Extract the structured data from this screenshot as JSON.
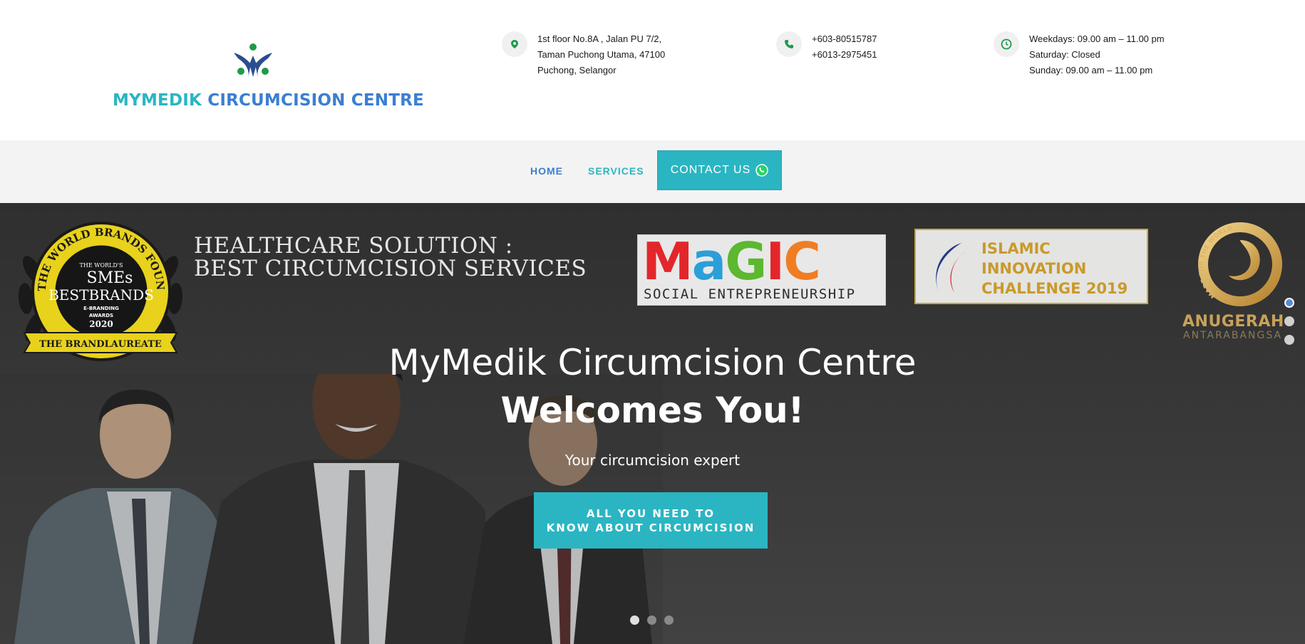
{
  "brand": {
    "name_part1": "MYMEDIK",
    "name_part2": "CIRCUMCISION CENTRE"
  },
  "header": {
    "address": {
      "icon": "location-pin-icon",
      "lines": [
        "1st floor No.8A , Jalan PU 7/2,",
        "Taman Puchong Utama, 47100",
        "Puchong, Selangor"
      ]
    },
    "phone": {
      "icon": "phone-icon",
      "lines": [
        "+603-80515787",
        "+6013-2975451"
      ]
    },
    "hours": {
      "icon": "clock-icon",
      "lines": [
        "Weekdays: 09.00 am – 11.00 pm",
        "Saturday: Closed",
        "Sunday: 09.00 am – 11.00 pm"
      ]
    }
  },
  "nav": {
    "home": "HOME",
    "services": "SERVICES",
    "contact": "CONTACT US",
    "contact_icon": "whatsapp-icon"
  },
  "hero": {
    "award_badge": {
      "arc_top": "THE WORLD BRANDS FOUNDATION",
      "center_small": "THE WORLD'S",
      "center_main1": "SMEs",
      "center_main2": "BESTBRANDS",
      "center_sub1": "E-BRANDING",
      "center_sub2": "AWARDS",
      "year": "2020",
      "ribbon": "THE BRANDLAUREATE"
    },
    "healthcare_line1": "HEALTHCARE SOLUTION :",
    "healthcare_line2": "BEST CIRCUMCISION SERVICES",
    "magic_logo": {
      "letters": [
        "M",
        "a",
        "G",
        "I",
        "C"
      ],
      "colors": [
        "#e3262b",
        "#2b9fd8",
        "#5bb82f",
        "#e4262b",
        "#f07d23"
      ],
      "subtitle": "SOCIAL ENTREPRENEURSHIP"
    },
    "islamic_logo": {
      "lines": [
        "ISLAMIC",
        "INNOVATION",
        "CHALLENGE 2019"
      ]
    },
    "anugerah_logo": {
      "ring_text": "MADE FOR THE WORLD",
      "main": "ANUGERAH",
      "sub": "ANTARABANGSA"
    },
    "title_line1": "MyMedik Circumcision Centre",
    "title_line2": "Welcomes You!",
    "tagline": "Your circumcision expert",
    "cta_line1": "ALL YOU NEED TO",
    "cta_line2": "KNOW ABOUT CIRCUMCISION",
    "active_slide": 1,
    "slide_count": 3,
    "side_active": 1,
    "side_count": 3
  },
  "colors": {
    "teal": "#2bb5c2",
    "blue": "#3b7fd1",
    "icon_green": "#1e9a4b",
    "hero_bg": "#333333"
  }
}
